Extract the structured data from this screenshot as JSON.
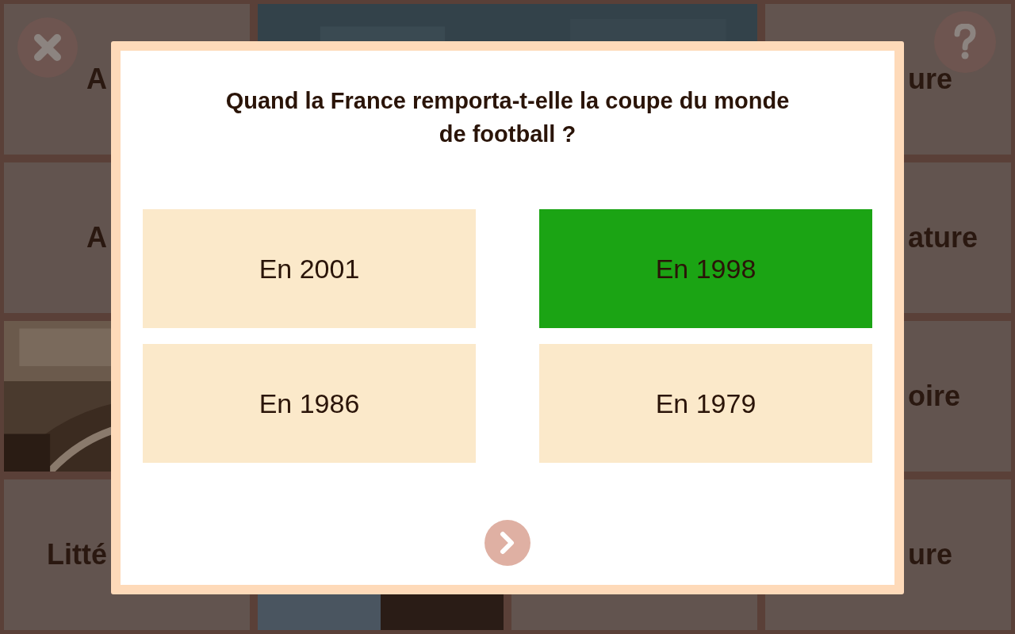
{
  "tiles": [
    {
      "kind": "label",
      "text": "A"
    },
    {
      "kind": "picture"
    },
    {
      "kind": "label",
      "text": "ure"
    },
    {
      "kind": "label",
      "text": "A"
    },
    {
      "kind": "label",
      "text": "ature"
    },
    {
      "kind": "picture"
    },
    {
      "kind": "label",
      "text": "oire"
    },
    {
      "kind": "label",
      "text": "Litté"
    },
    {
      "kind": "picture"
    },
    {
      "kind": "blank"
    },
    {
      "kind": "label",
      "text": "ure"
    }
  ],
  "quiz": {
    "question": "Quand la France remporta-t-elle la coupe du monde de football ?",
    "answers": [
      {
        "text": "En 2001",
        "selected": false
      },
      {
        "text": "En 1998",
        "selected": true
      },
      {
        "text": "En 1986",
        "selected": false
      },
      {
        "text": "En 1979",
        "selected": false
      }
    ]
  }
}
